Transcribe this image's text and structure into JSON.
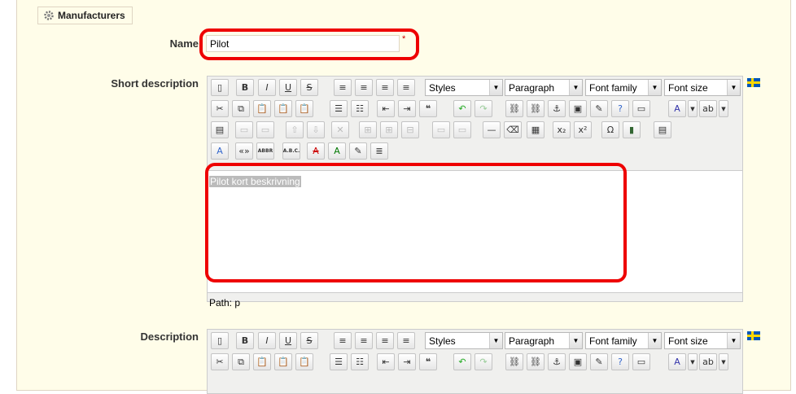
{
  "section": {
    "title": "Manufacturers"
  },
  "name_field": {
    "label": "Name",
    "value": "Pilot",
    "required_mark": "*"
  },
  "short_description": {
    "label": "Short description",
    "styles": "Styles",
    "paragraph": "Paragraph",
    "font_family": "Font family",
    "font_size": "Font size",
    "content": "Pilot kort beskrivning",
    "path": "Path: p"
  },
  "description": {
    "label": "Description",
    "styles": "Styles",
    "paragraph": "Paragraph",
    "font_family": "Font family",
    "font_size": "Font size"
  },
  "toolbar_glyphs": {
    "bold": "B",
    "italic": "I",
    "underline": "U",
    "strike": "S",
    "blockquote": "66",
    "sub": "x₂",
    "sup": "x²",
    "omega": "Ω",
    "cite": "«»",
    "abbr": "ABBR",
    "acronym": "A.B.C.",
    "a": "A"
  },
  "colors": {
    "accent_red": "#e00000",
    "fieldset_bg": "#fffde9"
  }
}
